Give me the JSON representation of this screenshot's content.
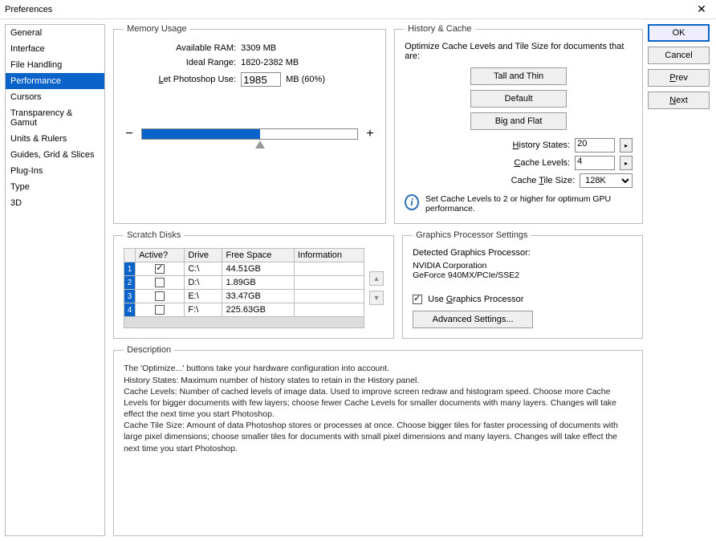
{
  "window": {
    "title": "Preferences"
  },
  "sidebar": {
    "items": [
      "General",
      "Interface",
      "File Handling",
      "Performance",
      "Cursors",
      "Transparency & Gamut",
      "Units & Rulers",
      "Guides, Grid & Slices",
      "Plug-Ins",
      "Type",
      "3D"
    ],
    "selected_index": 3
  },
  "buttons": {
    "ok": "OK",
    "cancel": "Cancel",
    "prev": "Prev",
    "next": "Next"
  },
  "memory": {
    "legend": "Memory Usage",
    "available_label": "Available RAM:",
    "available_value": "3309 MB",
    "ideal_label": "Ideal Range:",
    "ideal_value": "1820-2382 MB",
    "use_label": "Let Photoshop Use:",
    "use_value": "1985",
    "use_suffix": "MB (60%)",
    "minus": "−",
    "plus": "+"
  },
  "history": {
    "legend": "History & Cache",
    "optimize_text": "Optimize Cache Levels and Tile Size for documents that are:",
    "tall": "Tall and Thin",
    "default": "Default",
    "big": "Big and Flat",
    "states_label": "History States:",
    "states_value": "20",
    "levels_label": "Cache Levels:",
    "levels_value": "4",
    "tile_label": "Cache Tile Size:",
    "tile_value": "128K",
    "info_text": "Set Cache Levels to 2 or higher for optimum GPU performance."
  },
  "scratch": {
    "legend": "Scratch Disks",
    "headers": {
      "active": "Active?",
      "drive": "Drive",
      "free": "Free Space",
      "info": "Information"
    },
    "rows": [
      {
        "n": "1",
        "active": true,
        "drive": "C:\\",
        "free": "44.51GB",
        "info": ""
      },
      {
        "n": "2",
        "active": false,
        "drive": "D:\\",
        "free": "1.89GB",
        "info": ""
      },
      {
        "n": "3",
        "active": false,
        "drive": "E:\\",
        "free": "33.47GB",
        "info": ""
      },
      {
        "n": "4",
        "active": false,
        "drive": "F:\\",
        "free": "225.63GB",
        "info": ""
      }
    ]
  },
  "gps": {
    "legend": "Graphics Processor Settings",
    "detected_label": "Detected Graphics Processor:",
    "vendor": "NVIDIA Corporation",
    "model": "GeForce 940MX/PCIe/SSE2",
    "use_label": "Use Graphics Processor",
    "advanced": "Advanced Settings..."
  },
  "description": {
    "legend": "Description",
    "text": "The 'Optimize...' buttons take your hardware configuration into account.\nHistory States: Maximum number of history states to retain in the History panel.\nCache Levels: Number of cached levels of image data.  Used to improve screen redraw and histogram speed.  Choose more Cache Levels for bigger documents with few layers; choose fewer Cache Levels for smaller documents with many layers. Changes will take effect the next time you start Photoshop.\nCache Tile Size: Amount of data Photoshop stores or processes at once. Choose bigger tiles for faster processing of documents with large pixel dimensions; choose smaller tiles for documents with small pixel dimensions and many layers. Changes will take effect the next time you start Photoshop."
  }
}
